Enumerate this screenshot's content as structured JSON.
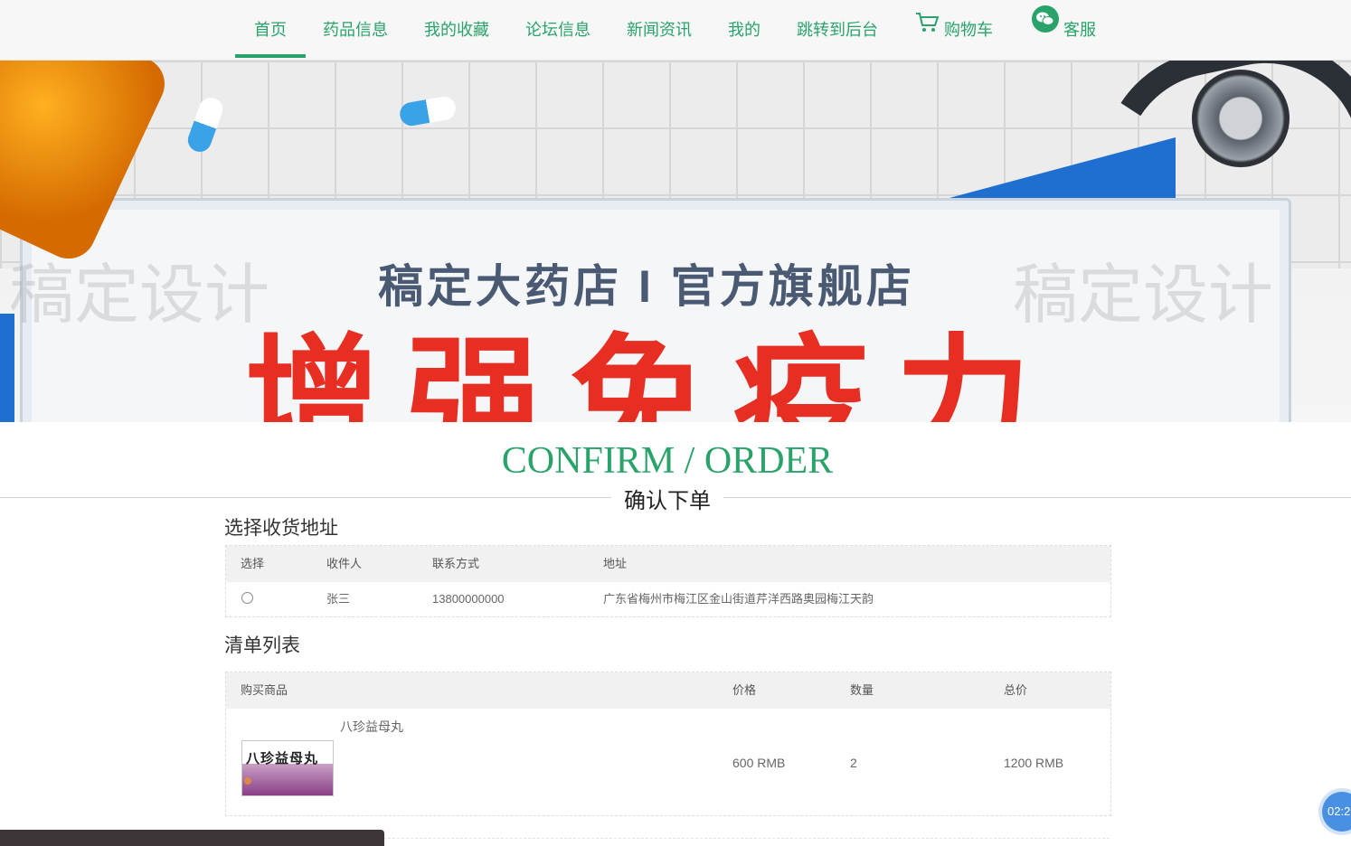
{
  "nav": {
    "items": [
      {
        "label": "首页",
        "active": true
      },
      {
        "label": "药品信息"
      },
      {
        "label": "我的收藏"
      },
      {
        "label": "论坛信息"
      },
      {
        "label": "新闻资讯"
      },
      {
        "label": "我的"
      },
      {
        "label": "跳转到后台"
      }
    ],
    "cart_label": "购物车",
    "service_label": "客服",
    "accent_color": "#2aa36b"
  },
  "banner": {
    "subtitle": "稿定大药店 I 官方旗舰店",
    "headline": "增强免疫力",
    "watermark": "稿定设计"
  },
  "section": {
    "title_en": "CONFIRM / ORDER",
    "title_cn": "确认下单"
  },
  "address": {
    "heading": "选择收货地址",
    "columns": [
      "选择",
      "收件人",
      "联系方式",
      "地址"
    ],
    "rows": [
      {
        "name": "张三",
        "phone": "13800000000",
        "address": "广东省梅州市梅江区金山街道芹洋西路奥园梅江天韵",
        "selected": false
      }
    ]
  },
  "order": {
    "heading": "清单列表",
    "columns": [
      "购买商品",
      "价格",
      "数量",
      "总价"
    ],
    "items": [
      {
        "name": "八珍益母丸",
        "image_text": "八珍益母丸",
        "price": "600 RMB",
        "quantity": "2",
        "total": "1200 RMB"
      }
    ]
  },
  "timer": "02:2"
}
